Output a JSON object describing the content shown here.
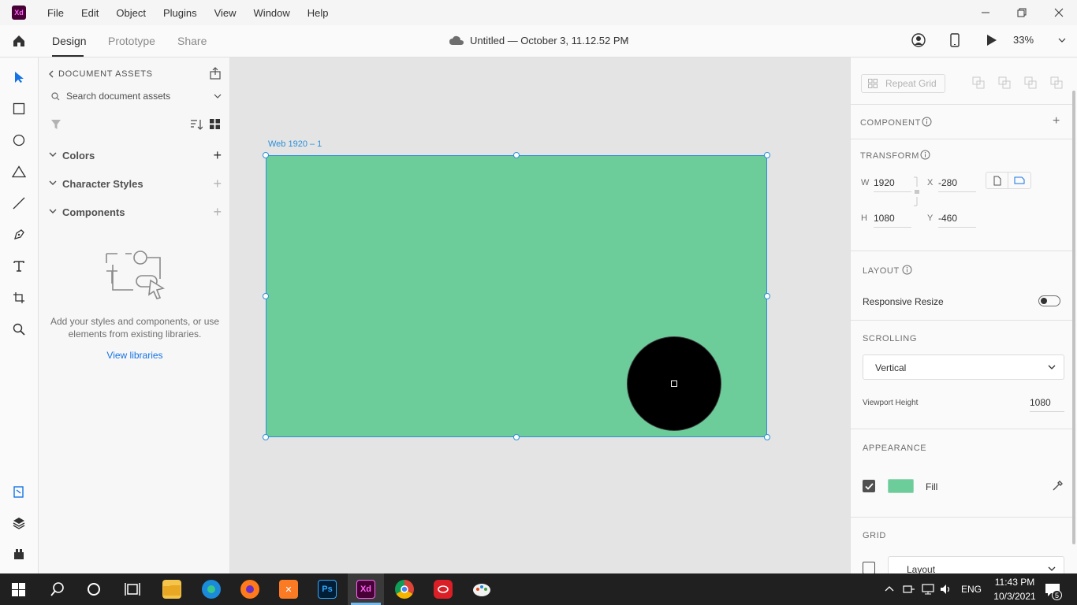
{
  "app": {
    "logo_text": "Xd"
  },
  "menubar": {
    "items": [
      "File",
      "Edit",
      "Object",
      "Plugins",
      "View",
      "Window",
      "Help"
    ]
  },
  "toolbar": {
    "tabs": [
      "Design",
      "Prototype",
      "Share"
    ],
    "active_tab": "Design",
    "document_title": "Untitled — October 3, 11.12.52 PM",
    "zoom": "33%"
  },
  "assets_panel": {
    "title": "DOCUMENT ASSETS",
    "search_placeholder": "Search document assets",
    "sections": [
      {
        "label": "Colors",
        "icon": "plus"
      },
      {
        "label": "Character Styles",
        "icon": "plus"
      },
      {
        "label": "Components",
        "icon": "plus"
      }
    ],
    "empty_message": "Add your styles and components, or use elements from existing libraries.",
    "view_libraries": "View libraries"
  },
  "canvas": {
    "artboard_name": "Web 1920 – 1",
    "artboard_fill": "#6ccd9b",
    "selection_color": "#2b8fd8"
  },
  "inspector": {
    "repeat_grid": "Repeat Grid",
    "component_label": "COMPONENT",
    "transform_label": "TRANSFORM",
    "width_label": "W",
    "width": "1920",
    "height_label": "H",
    "height": "1080",
    "x_label": "X",
    "x": "-280",
    "y_label": "Y",
    "y": "-460",
    "layout_label": "LAYOUT",
    "responsive_resize": "Responsive Resize",
    "scrolling_label": "SCROLLING",
    "scrolling_value": "Vertical",
    "viewport_height_label": "Viewport Height",
    "viewport_height": "1080",
    "appearance_label": "APPEARANCE",
    "fill_label": "Fill",
    "fill_color": "#6ccd9b",
    "grid_label": "GRID",
    "grid_value": "Layout"
  },
  "taskbar": {
    "lang": "ENG",
    "time": "11:43 PM",
    "date": "10/3/2021",
    "notification_count": "5",
    "apps": [
      "file-explorer",
      "edge",
      "firefox",
      "xampp",
      "photoshop",
      "xd",
      "chrome",
      "creative-cloud",
      "paint-3d"
    ]
  }
}
